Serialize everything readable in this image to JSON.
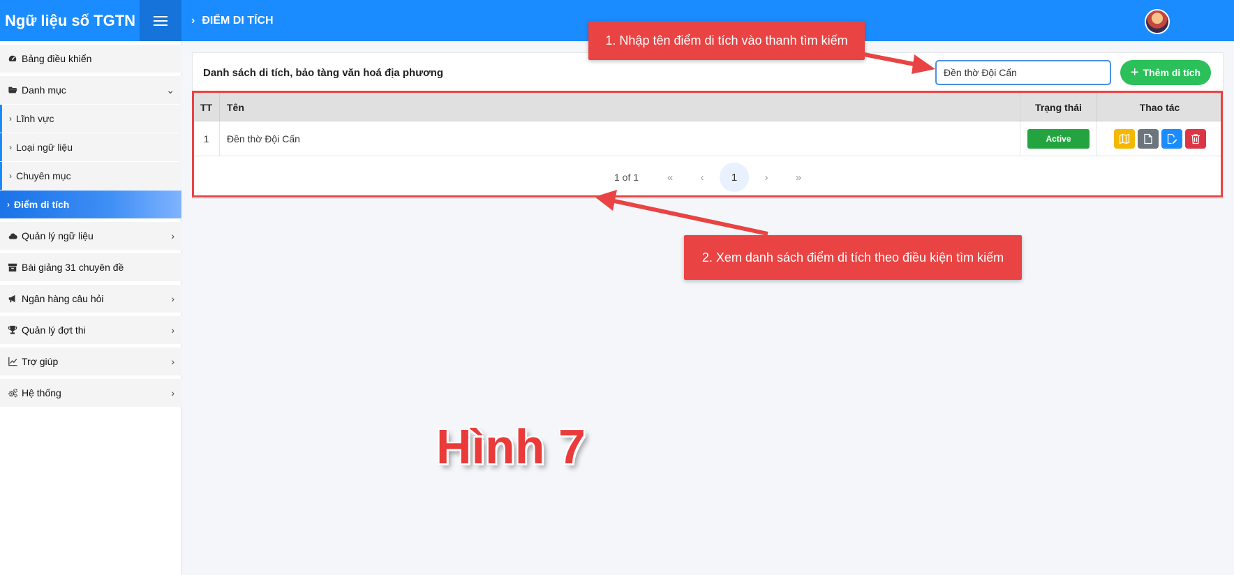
{
  "app": {
    "title": "Ngữ liệu số TGTN"
  },
  "header": {
    "breadcrumb": "ĐIỂM DI TÍCH"
  },
  "sidebar": {
    "items": [
      {
        "label": "Bảng điều khiển",
        "icon": "dashboard-icon"
      },
      {
        "label": "Danh mục",
        "icon": "folder-open-icon",
        "expanded": true
      },
      {
        "label": "Lĩnh vực"
      },
      {
        "label": "Loại ngữ liệu"
      },
      {
        "label": "Chuyên mục"
      },
      {
        "label": "Điểm di tích",
        "active": true
      },
      {
        "label": "Quản lý ngữ liệu",
        "icon": "cloud-icon"
      },
      {
        "label": "Bài giảng 31 chuyên đề",
        "icon": "archive-icon"
      },
      {
        "label": "Ngân hàng câu hỏi",
        "icon": "megaphone-icon"
      },
      {
        "label": "Quản lý đợt thi",
        "icon": "trophy-icon"
      },
      {
        "label": "Trợ giúp",
        "icon": "chart-icon"
      },
      {
        "label": "Hệ thống",
        "icon": "cogs-icon"
      }
    ]
  },
  "main": {
    "card_title": "Danh sách di tích, bảo tàng văn hoá địa phương",
    "search": {
      "value": "Đền thờ Đội Cấn"
    },
    "add_button": "Thêm di tích",
    "table": {
      "headers": [
        "TT",
        "Tên",
        "Trạng thái",
        "Thao tác"
      ],
      "rows": [
        {
          "index": "1",
          "name": "Đền thờ Đội Cấn",
          "status": "Active"
        }
      ]
    },
    "pagination": {
      "info": "1 of 1",
      "current": "1",
      "first": "«",
      "prev": "‹",
      "next": "›",
      "last": "»"
    }
  },
  "annotations": {
    "step1": "1. Nhập tên điểm di tích vào thanh tìm kiếm",
    "step2": "2. Xem danh sách điểm di tích theo điều kiện tìm kiếm",
    "figure": "Hình 7"
  },
  "colors": {
    "header": "#1a8cff",
    "active_status": "#23a441",
    "add_button": "#2cc05b",
    "annotation": "#e94343",
    "action_map": "#f5b800",
    "action_doc": "#6c757d",
    "action_edit": "#1a8cff",
    "action_delete": "#dc3545"
  }
}
